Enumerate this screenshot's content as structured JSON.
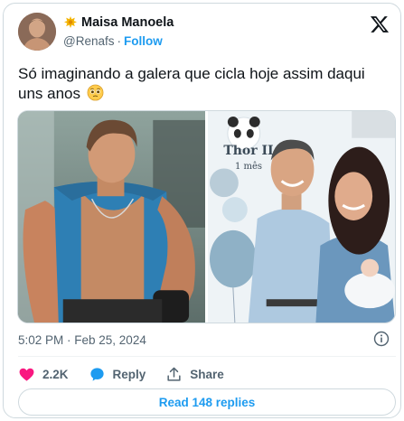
{
  "author": {
    "display_name": "Maisa Manoela",
    "handle": "@Renafs",
    "separator": "·",
    "follow_label": "Follow"
  },
  "tweet": {
    "text": "Só imaginando a galera que cicla hoje assim daqui uns anos",
    "emoji": "pleading-face-emoji"
  },
  "media": {
    "photo_right_caption_title": "Thor II",
    "photo_right_caption_sub": "1 mês"
  },
  "meta": {
    "timestamp": "5:02 PM · Feb 25, 2024"
  },
  "actions": {
    "likes_count": "2.2K",
    "reply_label": "Reply",
    "share_label": "Share"
  },
  "replies_button": {
    "label": "Read 148 replies"
  },
  "colors": {
    "accent": "#1d9bf0",
    "like": "#f91880",
    "secondary_text": "#536471",
    "border": "#cfd9de"
  }
}
